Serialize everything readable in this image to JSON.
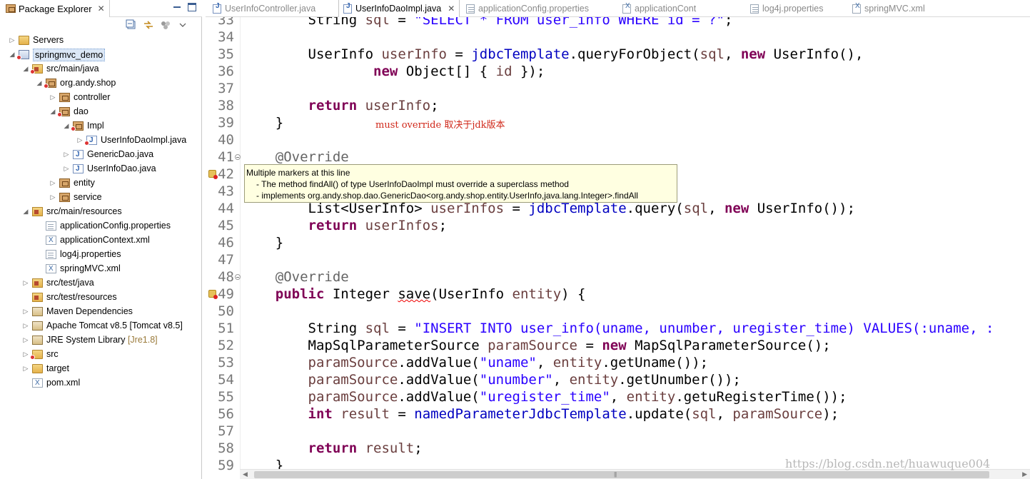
{
  "package_explorer": {
    "tab_label": "Package Explorer",
    "tree": [
      {
        "label": "Servers",
        "icon": "folder-icon",
        "twisty": "▷",
        "depth": 0
      },
      {
        "label": "springmvc_demo",
        "icon": "project-icon",
        "twisty": "◢",
        "depth": 0,
        "selected": true,
        "error": true
      },
      {
        "label": "src/main/java",
        "icon": "source-folder-icon",
        "twisty": "◢",
        "depth": 1,
        "error": true
      },
      {
        "label": "org.andy.shop",
        "icon": "package-icon",
        "twisty": "◢",
        "depth": 2,
        "error": true
      },
      {
        "label": "controller",
        "icon": "package-icon",
        "twisty": "▷",
        "depth": 3
      },
      {
        "label": "dao",
        "icon": "package-icon",
        "twisty": "◢",
        "depth": 3,
        "error": true
      },
      {
        "label": "Impl",
        "icon": "package-icon",
        "twisty": "◢",
        "depth": 4,
        "error": true
      },
      {
        "label": "UserInfoDaoImpl.java",
        "icon": "java-file-icon",
        "twisty": "▷",
        "depth": 5,
        "error": true
      },
      {
        "label": "GenericDao.java",
        "icon": "java-interface-icon",
        "twisty": "▷",
        "depth": 4
      },
      {
        "label": "UserInfoDao.java",
        "icon": "java-interface-icon",
        "twisty": "▷",
        "depth": 4
      },
      {
        "label": "entity",
        "icon": "package-icon",
        "twisty": "▷",
        "depth": 3
      },
      {
        "label": "service",
        "icon": "package-icon",
        "twisty": "▷",
        "depth": 3
      },
      {
        "label": "src/main/resources",
        "icon": "source-folder-icon",
        "twisty": "◢",
        "depth": 1
      },
      {
        "label": "applicationConfig.properties",
        "icon": "properties-file-icon",
        "twisty": "",
        "depth": 2
      },
      {
        "label": "applicationContext.xml",
        "icon": "xml-file-icon",
        "twisty": "",
        "depth": 2
      },
      {
        "label": "log4j.properties",
        "icon": "properties-file-icon",
        "twisty": "",
        "depth": 2
      },
      {
        "label": "springMVC.xml",
        "icon": "xml-file-icon",
        "twisty": "",
        "depth": 2
      },
      {
        "label": "src/test/java",
        "icon": "source-folder-icon",
        "twisty": "▷",
        "depth": 1
      },
      {
        "label": "src/test/resources",
        "icon": "source-folder-icon",
        "twisty": "",
        "depth": 1
      },
      {
        "label": "Maven Dependencies",
        "icon": "library-icon",
        "twisty": "▷",
        "depth": 1
      },
      {
        "label": "Apache Tomcat v8.5 [Tomcat v8.5]",
        "icon": "library-icon",
        "twisty": "▷",
        "depth": 1
      },
      {
        "label": "JRE System Library",
        "decor": "[Jre1.8]",
        "icon": "library-icon",
        "twisty": "▷",
        "depth": 1
      },
      {
        "label": "src",
        "icon": "folder-icon",
        "twisty": "▷",
        "depth": 1,
        "error": true
      },
      {
        "label": "target",
        "icon": "folder-icon",
        "twisty": "▷",
        "depth": 1
      },
      {
        "label": "pom.xml",
        "icon": "xml-file-icon",
        "twisty": "",
        "depth": 1
      }
    ]
  },
  "editor_tabs": [
    {
      "label": "UserInfoController.java",
      "icon": "java-file-icon",
      "active": false
    },
    {
      "label": "UserInfoDaoImpl.java",
      "icon": "java-file-icon",
      "active": true
    },
    {
      "label": "applicationConfig.properties",
      "icon": "properties-file-icon",
      "active": false
    },
    {
      "label": "applicationCont",
      "icon": "xml-file-icon",
      "active": false
    },
    {
      "label": "log4j.properties",
      "icon": "properties-file-icon",
      "active": false
    },
    {
      "label": "springMVC.xml",
      "icon": "xml-file-icon",
      "active": false
    }
  ],
  "code_lines": [
    {
      "n": "33",
      "tokens": [
        [
          "        ",
          ""
        ],
        [
          "String ",
          ""
        ],
        [
          "sql",
          "var"
        ],
        [
          " = ",
          ""
        ],
        [
          "\"SELECT * FROM user_info WHERE id = ?\"",
          "str"
        ],
        [
          ";",
          ""
        ]
      ]
    },
    {
      "n": "34",
      "tokens": []
    },
    {
      "n": "35",
      "tokens": [
        [
          "        UserInfo ",
          ""
        ],
        [
          "userInfo",
          "var"
        ],
        [
          " = ",
          ""
        ],
        [
          "jdbcTemplate",
          "fld"
        ],
        [
          ".queryForObject(",
          ""
        ],
        [
          "sql",
          "var"
        ],
        [
          ", ",
          ""
        ],
        [
          "new",
          "kw"
        ],
        [
          " UserInfo(),",
          ""
        ]
      ]
    },
    {
      "n": "36",
      "tokens": [
        [
          "                ",
          ""
        ],
        [
          "new",
          "kw"
        ],
        [
          " Object[] { ",
          ""
        ],
        [
          "id",
          "var"
        ],
        [
          " });",
          ""
        ]
      ]
    },
    {
      "n": "37",
      "tokens": []
    },
    {
      "n": "38",
      "tokens": [
        [
          "        ",
          ""
        ],
        [
          "return",
          "kw"
        ],
        [
          " ",
          ""
        ],
        [
          "userInfo",
          "var"
        ],
        [
          ";",
          ""
        ]
      ]
    },
    {
      "n": "39",
      "tokens": [
        [
          "    }",
          ""
        ]
      ]
    },
    {
      "n": "40",
      "tokens": []
    },
    {
      "n": "41",
      "tokens": [
        [
          "    ",
          ""
        ],
        [
          "@Override",
          "ann"
        ]
      ],
      "fold": true
    },
    {
      "n": "42",
      "tokens": [],
      "marker": true
    },
    {
      "n": "43",
      "tokens": []
    },
    {
      "n": "44",
      "tokens": [
        [
          "        List<UserInfo> ",
          ""
        ],
        [
          "userInfos",
          "var"
        ],
        [
          " = ",
          ""
        ],
        [
          "jdbcTemplate",
          "fld"
        ],
        [
          ".query(",
          ""
        ],
        [
          "sql",
          "var"
        ],
        [
          ", ",
          ""
        ],
        [
          "new",
          "kw"
        ],
        [
          " UserInfo());",
          ""
        ]
      ]
    },
    {
      "n": "45",
      "tokens": [
        [
          "        ",
          ""
        ],
        [
          "return",
          "kw"
        ],
        [
          " ",
          ""
        ],
        [
          "userInfos",
          "var"
        ],
        [
          ";",
          ""
        ]
      ]
    },
    {
      "n": "46",
      "tokens": [
        [
          "    }",
          ""
        ]
      ]
    },
    {
      "n": "47",
      "tokens": []
    },
    {
      "n": "48",
      "tokens": [
        [
          "    ",
          ""
        ],
        [
          "@Override",
          "ann"
        ]
      ],
      "fold": true
    },
    {
      "n": "49",
      "tokens": [
        [
          "    ",
          ""
        ],
        [
          "public",
          "kw"
        ],
        [
          " Integer ",
          ""
        ],
        [
          "save",
          "squig"
        ],
        [
          "(UserInfo ",
          ""
        ],
        [
          "entity",
          "var"
        ],
        [
          ") {",
          ""
        ]
      ],
      "marker": true
    },
    {
      "n": "50",
      "tokens": []
    },
    {
      "n": "51",
      "tokens": [
        [
          "        String ",
          ""
        ],
        [
          "sql",
          "var"
        ],
        [
          " = ",
          ""
        ],
        [
          "\"INSERT INTO user_info(uname, unumber, uregister_time) VALUES(:uname, :",
          "str"
        ]
      ]
    },
    {
      "n": "52",
      "tokens": [
        [
          "        MapSqlParameterSource ",
          ""
        ],
        [
          "paramSource",
          "var"
        ],
        [
          " = ",
          ""
        ],
        [
          "new",
          "kw"
        ],
        [
          " MapSqlParameterSource();",
          ""
        ]
      ]
    },
    {
      "n": "53",
      "tokens": [
        [
          "        ",
          ""
        ],
        [
          "paramSource",
          "var"
        ],
        [
          ".addValue(",
          ""
        ],
        [
          "\"uname\"",
          "str"
        ],
        [
          ", ",
          ""
        ],
        [
          "entity",
          "var"
        ],
        [
          ".getUname());",
          ""
        ]
      ]
    },
    {
      "n": "54",
      "tokens": [
        [
          "        ",
          ""
        ],
        [
          "paramSource",
          "var"
        ],
        [
          ".addValue(",
          ""
        ],
        [
          "\"unumber\"",
          "str"
        ],
        [
          ", ",
          ""
        ],
        [
          "entity",
          "var"
        ],
        [
          ".getUnumber());",
          ""
        ]
      ]
    },
    {
      "n": "55",
      "tokens": [
        [
          "        ",
          ""
        ],
        [
          "paramSource",
          "var"
        ],
        [
          ".addValue(",
          ""
        ],
        [
          "\"uregister_time\"",
          "str"
        ],
        [
          ", ",
          ""
        ],
        [
          "entity",
          "var"
        ],
        [
          ".getuRegisterTime());",
          ""
        ]
      ]
    },
    {
      "n": "56",
      "tokens": [
        [
          "        ",
          ""
        ],
        [
          "int",
          "kw"
        ],
        [
          " ",
          ""
        ],
        [
          "result",
          "var"
        ],
        [
          " = ",
          ""
        ],
        [
          "namedParameterJdbcTemplate",
          "fld"
        ],
        [
          ".update(",
          ""
        ],
        [
          "sql",
          "var"
        ],
        [
          ", ",
          ""
        ],
        [
          "paramSource",
          "var"
        ],
        [
          ");",
          ""
        ]
      ]
    },
    {
      "n": "57",
      "tokens": []
    },
    {
      "n": "58",
      "tokens": [
        [
          "        ",
          ""
        ],
        [
          "return",
          "kw"
        ],
        [
          " ",
          ""
        ],
        [
          "result",
          "var"
        ],
        [
          ";",
          ""
        ]
      ]
    },
    {
      "n": "59",
      "tokens": [
        [
          "    }",
          ""
        ]
      ]
    }
  ],
  "annotation_note": "must override 取决于jdk版本",
  "hover": {
    "title": "Multiple markers at this line",
    "line1": "- The method findAll() of type UserInfoDaoImpl must override a superclass method",
    "line2": "- implements org.andy.shop.dao.GenericDao<org.andy.shop.entity.UserInfo,java.lang.Integer>.findAll"
  },
  "watermark": "https://blog.csdn.net/huawuque004",
  "colors": {
    "keyword": "#7f0055",
    "string": "#2a00ff",
    "annotation": "#646464",
    "field": "#0000c0",
    "note": "#d0281a",
    "hover_bg": "#ffffe1"
  }
}
